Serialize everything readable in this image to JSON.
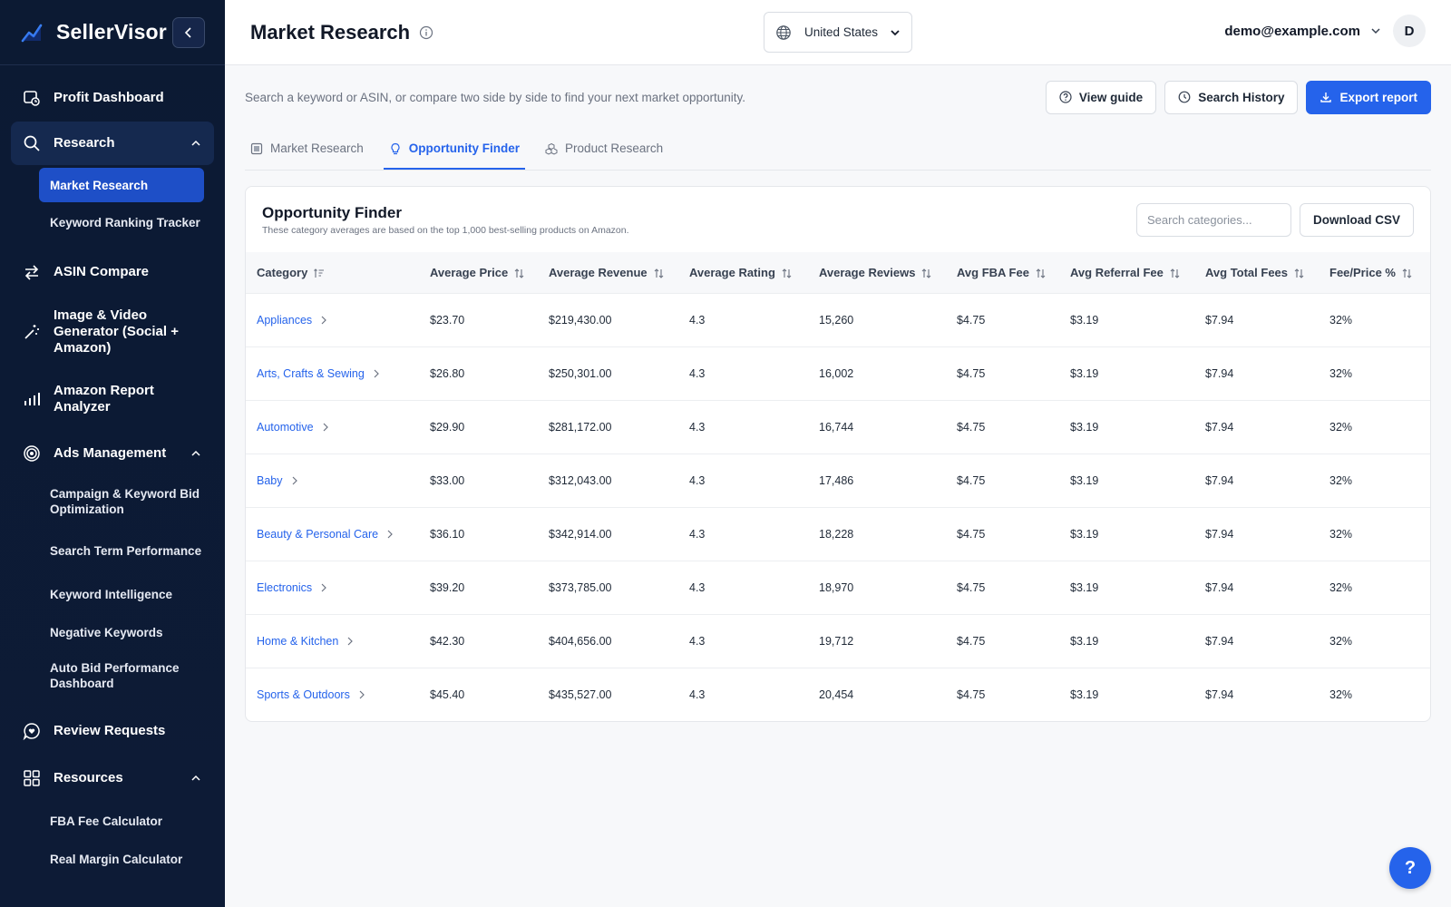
{
  "brand": {
    "name": "SellerVisor"
  },
  "sidebar": {
    "items": [
      {
        "label": "Profit Dashboard",
        "icon": "dashboard-icon"
      },
      {
        "label": "Research",
        "icon": "search-icon",
        "children": [
          {
            "label": "Market Research",
            "active": true
          },
          {
            "label": "Keyword Ranking Tracker"
          }
        ]
      },
      {
        "label": "ASIN Compare",
        "icon": "compare-arrows-icon"
      },
      {
        "label": "Image & Video Generator (Social + Amazon)",
        "icon": "magic-wand-icon"
      },
      {
        "label": "Amazon Report Analyzer",
        "icon": "bar-chart-icon"
      },
      {
        "label": "Ads Management",
        "icon": "target-icon",
        "children": [
          {
            "label": "Campaign & Keyword Bid Optimization"
          },
          {
            "label": "Search Term Performance"
          },
          {
            "label": "Keyword Intelligence"
          },
          {
            "label": "Negative Keywords"
          },
          {
            "label": "Auto Bid Performance Dashboard"
          }
        ]
      },
      {
        "label": "Review Requests",
        "icon": "review-bubble-icon"
      },
      {
        "label": "Resources",
        "icon": "grid-icon",
        "children": [
          {
            "label": "FBA Fee Calculator"
          },
          {
            "label": "Real Margin Calculator"
          }
        ]
      }
    ]
  },
  "header": {
    "title": "Market Research",
    "country": "United States",
    "email": "demo@example.com",
    "avatar_initial": "D"
  },
  "main": {
    "description": "Search a keyword or ASIN, or compare two side by side to find your next market opportunity.",
    "buttons": {
      "view_guide": "View guide",
      "search_history": "Search History",
      "export": "Export report"
    },
    "tabs": [
      {
        "label": "Market Research"
      },
      {
        "label": "Opportunity Finder",
        "active": true
      },
      {
        "label": "Product Research"
      }
    ]
  },
  "card": {
    "title": "Opportunity Finder",
    "subtitle": "These category averages are based on the top 1,000 best-selling products on Amazon.",
    "search_placeholder": "Search categories...",
    "download_label": "Download CSV"
  },
  "table": {
    "columns": [
      "Category",
      "Average Price",
      "Average Revenue",
      "Average Rating",
      "Average Reviews",
      "Avg FBA Fee",
      "Avg Referral Fee",
      "Avg Total Fees",
      "Fee/Price %"
    ],
    "rows": [
      [
        "Appliances",
        "$23.70",
        "$219,430.00",
        "4.3",
        "15,260",
        "$4.75",
        "$3.19",
        "$7.94",
        "32%"
      ],
      [
        "Arts, Crafts & Sewing",
        "$26.80",
        "$250,301.00",
        "4.3",
        "16,002",
        "$4.75",
        "$3.19",
        "$7.94",
        "32%"
      ],
      [
        "Automotive",
        "$29.90",
        "$281,172.00",
        "4.3",
        "16,744",
        "$4.75",
        "$3.19",
        "$7.94",
        "32%"
      ],
      [
        "Baby",
        "$33.00",
        "$312,043.00",
        "4.3",
        "17,486",
        "$4.75",
        "$3.19",
        "$7.94",
        "32%"
      ],
      [
        "Beauty & Personal Care",
        "$36.10",
        "$342,914.00",
        "4.3",
        "18,228",
        "$4.75",
        "$3.19",
        "$7.94",
        "32%"
      ],
      [
        "Electronics",
        "$39.20",
        "$373,785.00",
        "4.3",
        "18,970",
        "$4.75",
        "$3.19",
        "$7.94",
        "32%"
      ],
      [
        "Home & Kitchen",
        "$42.30",
        "$404,656.00",
        "4.3",
        "19,712",
        "$4.75",
        "$3.19",
        "$7.94",
        "32%"
      ],
      [
        "Sports & Outdoors",
        "$45.40",
        "$435,527.00",
        "4.3",
        "20,454",
        "$4.75",
        "$3.19",
        "$7.94",
        "32%"
      ]
    ]
  },
  "help": {
    "label": "?"
  },
  "colors": {
    "accent": "#2563eb",
    "sidebar_bg": "#0c1a33",
    "sidebar_active": "#1e4fc7"
  }
}
